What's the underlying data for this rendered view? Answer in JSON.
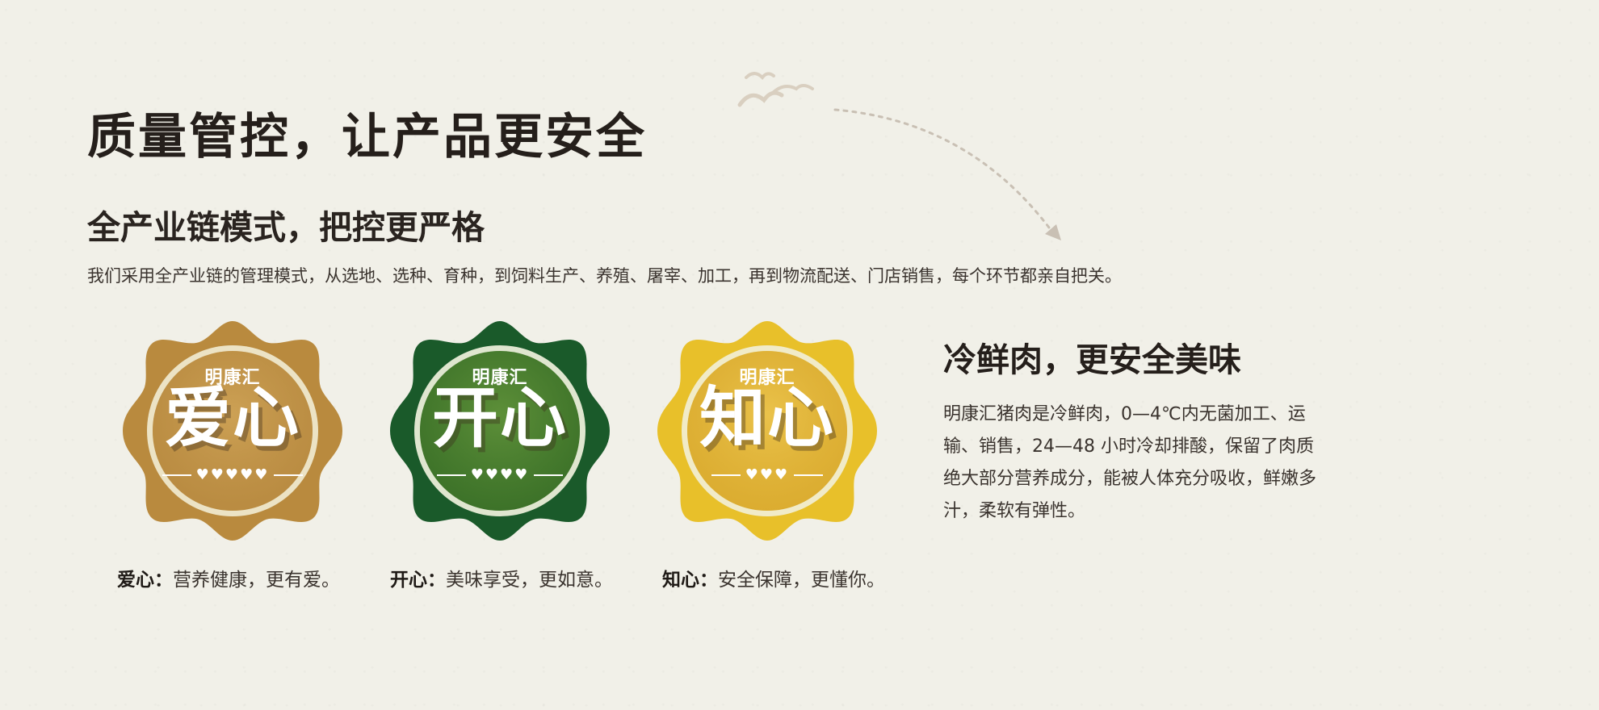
{
  "heading": {
    "title": "质量管控，让产品更安全",
    "subtitle": "全产业链模式，把控更严格",
    "description": "我们采用全产业链的管理模式，从选地、选种、育种，到饲料生产、养殖、屠宰、加工，再到物流配送、门店销售，每个环节都亲自把关。"
  },
  "badges": [
    {
      "brand": "明康汇",
      "word": "爱心",
      "hearts": "♥♥♥♥♥",
      "caption_label": "爱心：",
      "caption_text": "营养健康，更有爱。",
      "color_outer": "#b98a3e",
      "color_inner": "#c5974a"
    },
    {
      "brand": "明康汇",
      "word": "开心",
      "hearts": "♥♥♥♥",
      "caption_label": "开心：",
      "caption_text": "美味享受，更如意。",
      "color_outer": "#1a5a2a",
      "color_inner": "#4a7f2e"
    },
    {
      "brand": "明康汇",
      "word": "知心",
      "hearts": "♥♥♥",
      "caption_label": "知心：",
      "caption_text": "安全保障，更懂你。",
      "color_outer": "#e8c02a",
      "color_inner": "#e2b63a"
    }
  ],
  "side": {
    "title": "冷鲜肉，更安全美味",
    "text": "明康汇猪肉是冷鲜肉，0—4℃内无菌加工、运输、销售，24—48 小时冷却排酸，保留了肉质绝大部分营养成分，能被人体充分吸收，鲜嫩多汁，柔软有弹性。"
  },
  "icons": {
    "birds": "birds-icon",
    "arrow": "dashed-arrow-icon"
  }
}
